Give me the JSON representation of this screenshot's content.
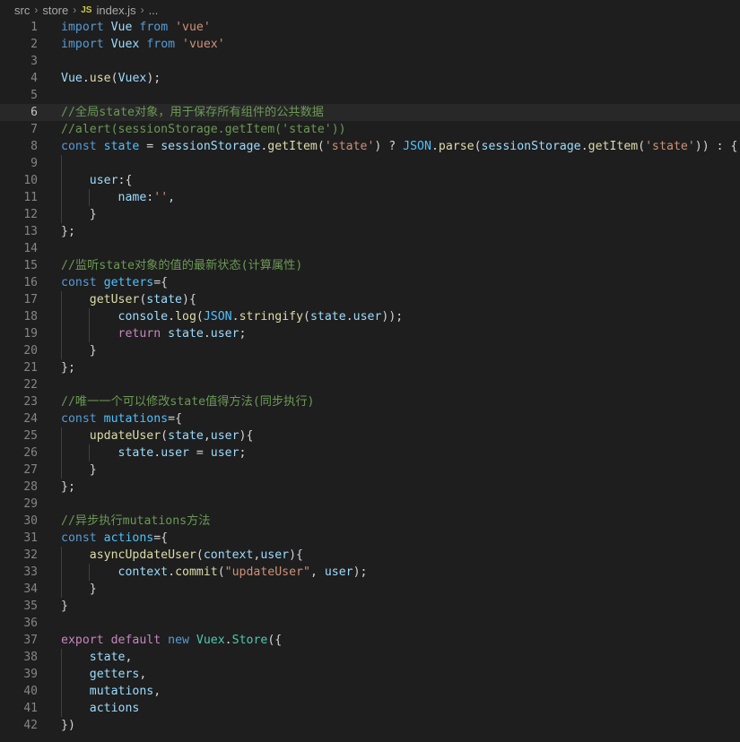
{
  "breadcrumb": {
    "folder1": "src",
    "folder2": "store",
    "file_icon": "JS",
    "file": "index.js",
    "ellipsis": "..."
  },
  "editor": {
    "active_line": 6,
    "colors": {
      "background": "#1e1e1e",
      "keyword": "#569cd6",
      "control": "#c586c0",
      "string": "#ce9178",
      "comment": "#6a9955",
      "function": "#dcdcaa",
      "variable": "#9cdcfe",
      "constant": "#4fc1ff",
      "class": "#4ec9b0"
    },
    "lines": [
      {
        "n": "1",
        "indent": 0,
        "tokens": [
          [
            "kw",
            "import"
          ],
          [
            "pl",
            " "
          ],
          [
            "var",
            "Vue"
          ],
          [
            "pl",
            " "
          ],
          [
            "kw",
            "from"
          ],
          [
            "pl",
            " "
          ],
          [
            "str",
            "'vue'"
          ]
        ]
      },
      {
        "n": "2",
        "indent": 0,
        "tokens": [
          [
            "kw",
            "import"
          ],
          [
            "pl",
            " "
          ],
          [
            "var",
            "Vuex"
          ],
          [
            "pl",
            " "
          ],
          [
            "kw",
            "from"
          ],
          [
            "pl",
            " "
          ],
          [
            "str",
            "'vuex'"
          ]
        ]
      },
      {
        "n": "3",
        "indent": 0,
        "tokens": []
      },
      {
        "n": "4",
        "indent": 0,
        "tokens": [
          [
            "var",
            "Vue"
          ],
          [
            "pl",
            "."
          ],
          [
            "fn",
            "use"
          ],
          [
            "pl",
            "("
          ],
          [
            "var",
            "Vuex"
          ],
          [
            "pl",
            ");"
          ]
        ]
      },
      {
        "n": "5",
        "indent": 0,
        "tokens": []
      },
      {
        "n": "6",
        "indent": 0,
        "tokens": [
          [
            "cm",
            "//全局state对象，用于保存所有组件的公共数据"
          ]
        ]
      },
      {
        "n": "7",
        "indent": 0,
        "tokens": [
          [
            "cm",
            "//alert(sessionStorage.getItem('state'))"
          ]
        ]
      },
      {
        "n": "8",
        "indent": 0,
        "tokens": [
          [
            "kw",
            "const"
          ],
          [
            "pl",
            " "
          ],
          [
            "const",
            "state"
          ],
          [
            "pl",
            " = "
          ],
          [
            "var",
            "sessionStorage"
          ],
          [
            "pl",
            "."
          ],
          [
            "fn",
            "getItem"
          ],
          [
            "pl",
            "("
          ],
          [
            "str",
            "'state'"
          ],
          [
            "pl",
            ") ? "
          ],
          [
            "const",
            "JSON"
          ],
          [
            "pl",
            "."
          ],
          [
            "fn",
            "parse"
          ],
          [
            "pl",
            "("
          ],
          [
            "var",
            "sessionStorage"
          ],
          [
            "pl",
            "."
          ],
          [
            "fn",
            "getItem"
          ],
          [
            "pl",
            "("
          ],
          [
            "str",
            "'state'"
          ],
          [
            "pl",
            ")) : {"
          ]
        ]
      },
      {
        "n": "9",
        "indent": 1,
        "tokens": []
      },
      {
        "n": "10",
        "indent": 1,
        "tokens": [
          [
            "pl",
            "    "
          ],
          [
            "var",
            "user"
          ],
          [
            "pl",
            ":{"
          ]
        ]
      },
      {
        "n": "11",
        "indent": 2,
        "tokens": [
          [
            "pl",
            "        "
          ],
          [
            "var",
            "name"
          ],
          [
            "pl",
            ":"
          ],
          [
            "str",
            "''"
          ],
          [
            "pl",
            ","
          ]
        ]
      },
      {
        "n": "12",
        "indent": 1,
        "tokens": [
          [
            "pl",
            "    }"
          ]
        ]
      },
      {
        "n": "13",
        "indent": 0,
        "tokens": [
          [
            "pl",
            "};"
          ]
        ]
      },
      {
        "n": "14",
        "indent": 0,
        "tokens": []
      },
      {
        "n": "15",
        "indent": 0,
        "tokens": [
          [
            "cm",
            "//监听state对象的值的最新状态(计算属性)"
          ]
        ]
      },
      {
        "n": "16",
        "indent": 0,
        "tokens": [
          [
            "kw",
            "const"
          ],
          [
            "pl",
            " "
          ],
          [
            "const",
            "getters"
          ],
          [
            "pl",
            "={"
          ]
        ]
      },
      {
        "n": "17",
        "indent": 1,
        "tokens": [
          [
            "pl",
            "    "
          ],
          [
            "fn",
            "getUser"
          ],
          [
            "pl",
            "("
          ],
          [
            "var",
            "state"
          ],
          [
            "pl",
            "){"
          ]
        ]
      },
      {
        "n": "18",
        "indent": 2,
        "tokens": [
          [
            "pl",
            "        "
          ],
          [
            "var",
            "console"
          ],
          [
            "pl",
            "."
          ],
          [
            "fn",
            "log"
          ],
          [
            "pl",
            "("
          ],
          [
            "const",
            "JSON"
          ],
          [
            "pl",
            "."
          ],
          [
            "fn",
            "stringify"
          ],
          [
            "pl",
            "("
          ],
          [
            "var",
            "state"
          ],
          [
            "pl",
            "."
          ],
          [
            "var",
            "user"
          ],
          [
            "pl",
            "));"
          ]
        ]
      },
      {
        "n": "19",
        "indent": 2,
        "tokens": [
          [
            "pl",
            "        "
          ],
          [
            "ctl",
            "return"
          ],
          [
            "pl",
            " "
          ],
          [
            "var",
            "state"
          ],
          [
            "pl",
            "."
          ],
          [
            "var",
            "user"
          ],
          [
            "pl",
            ";"
          ]
        ]
      },
      {
        "n": "20",
        "indent": 1,
        "tokens": [
          [
            "pl",
            "    }"
          ]
        ]
      },
      {
        "n": "21",
        "indent": 0,
        "tokens": [
          [
            "pl",
            "};"
          ]
        ]
      },
      {
        "n": "22",
        "indent": 0,
        "tokens": []
      },
      {
        "n": "23",
        "indent": 0,
        "tokens": [
          [
            "cm",
            "//唯一一个可以修改state值得方法(同步执行)"
          ]
        ]
      },
      {
        "n": "24",
        "indent": 0,
        "tokens": [
          [
            "kw",
            "const"
          ],
          [
            "pl",
            " "
          ],
          [
            "const",
            "mutations"
          ],
          [
            "pl",
            "={"
          ]
        ]
      },
      {
        "n": "25",
        "indent": 1,
        "tokens": [
          [
            "pl",
            "    "
          ],
          [
            "fn",
            "updateUser"
          ],
          [
            "pl",
            "("
          ],
          [
            "var",
            "state"
          ],
          [
            "pl",
            ","
          ],
          [
            "var",
            "user"
          ],
          [
            "pl",
            "){"
          ]
        ]
      },
      {
        "n": "26",
        "indent": 2,
        "tokens": [
          [
            "pl",
            "        "
          ],
          [
            "var",
            "state"
          ],
          [
            "pl",
            "."
          ],
          [
            "var",
            "user"
          ],
          [
            "pl",
            " = "
          ],
          [
            "var",
            "user"
          ],
          [
            "pl",
            ";"
          ]
        ]
      },
      {
        "n": "27",
        "indent": 1,
        "tokens": [
          [
            "pl",
            "    }"
          ]
        ]
      },
      {
        "n": "28",
        "indent": 0,
        "tokens": [
          [
            "pl",
            "};"
          ]
        ]
      },
      {
        "n": "29",
        "indent": 0,
        "tokens": []
      },
      {
        "n": "30",
        "indent": 0,
        "tokens": [
          [
            "cm",
            "//异步执行mutations方法"
          ]
        ]
      },
      {
        "n": "31",
        "indent": 0,
        "tokens": [
          [
            "kw",
            "const"
          ],
          [
            "pl",
            " "
          ],
          [
            "const",
            "actions"
          ],
          [
            "pl",
            "={"
          ]
        ]
      },
      {
        "n": "32",
        "indent": 1,
        "tokens": [
          [
            "pl",
            "    "
          ],
          [
            "fn",
            "asyncUpdateUser"
          ],
          [
            "pl",
            "("
          ],
          [
            "var",
            "context"
          ],
          [
            "pl",
            ","
          ],
          [
            "var",
            "user"
          ],
          [
            "pl",
            "){"
          ]
        ]
      },
      {
        "n": "33",
        "indent": 2,
        "tokens": [
          [
            "pl",
            "        "
          ],
          [
            "var",
            "context"
          ],
          [
            "pl",
            "."
          ],
          [
            "fn",
            "commit"
          ],
          [
            "pl",
            "("
          ],
          [
            "str",
            "\"updateUser\""
          ],
          [
            "pl",
            ", "
          ],
          [
            "var",
            "user"
          ],
          [
            "pl",
            ");"
          ]
        ]
      },
      {
        "n": "34",
        "indent": 1,
        "tokens": [
          [
            "pl",
            "    }"
          ]
        ]
      },
      {
        "n": "35",
        "indent": 0,
        "tokens": [
          [
            "pl",
            "}"
          ]
        ]
      },
      {
        "n": "36",
        "indent": 0,
        "tokens": []
      },
      {
        "n": "37",
        "indent": 0,
        "tokens": [
          [
            "ctl",
            "export"
          ],
          [
            "pl",
            " "
          ],
          [
            "ctl",
            "default"
          ],
          [
            "pl",
            " "
          ],
          [
            "kw",
            "new"
          ],
          [
            "pl",
            " "
          ],
          [
            "cls",
            "Vuex"
          ],
          [
            "pl",
            "."
          ],
          [
            "cls",
            "Store"
          ],
          [
            "pl",
            "({"
          ]
        ]
      },
      {
        "n": "38",
        "indent": 1,
        "tokens": [
          [
            "pl",
            "    "
          ],
          [
            "var",
            "state"
          ],
          [
            "pl",
            ","
          ]
        ]
      },
      {
        "n": "39",
        "indent": 1,
        "tokens": [
          [
            "pl",
            "    "
          ],
          [
            "var",
            "getters"
          ],
          [
            "pl",
            ","
          ]
        ]
      },
      {
        "n": "40",
        "indent": 1,
        "tokens": [
          [
            "pl",
            "    "
          ],
          [
            "var",
            "mutations"
          ],
          [
            "pl",
            ","
          ]
        ]
      },
      {
        "n": "41",
        "indent": 1,
        "tokens": [
          [
            "pl",
            "    "
          ],
          [
            "var",
            "actions"
          ]
        ]
      },
      {
        "n": "42",
        "indent": 0,
        "tokens": [
          [
            "pl",
            "})"
          ]
        ]
      }
    ]
  }
}
